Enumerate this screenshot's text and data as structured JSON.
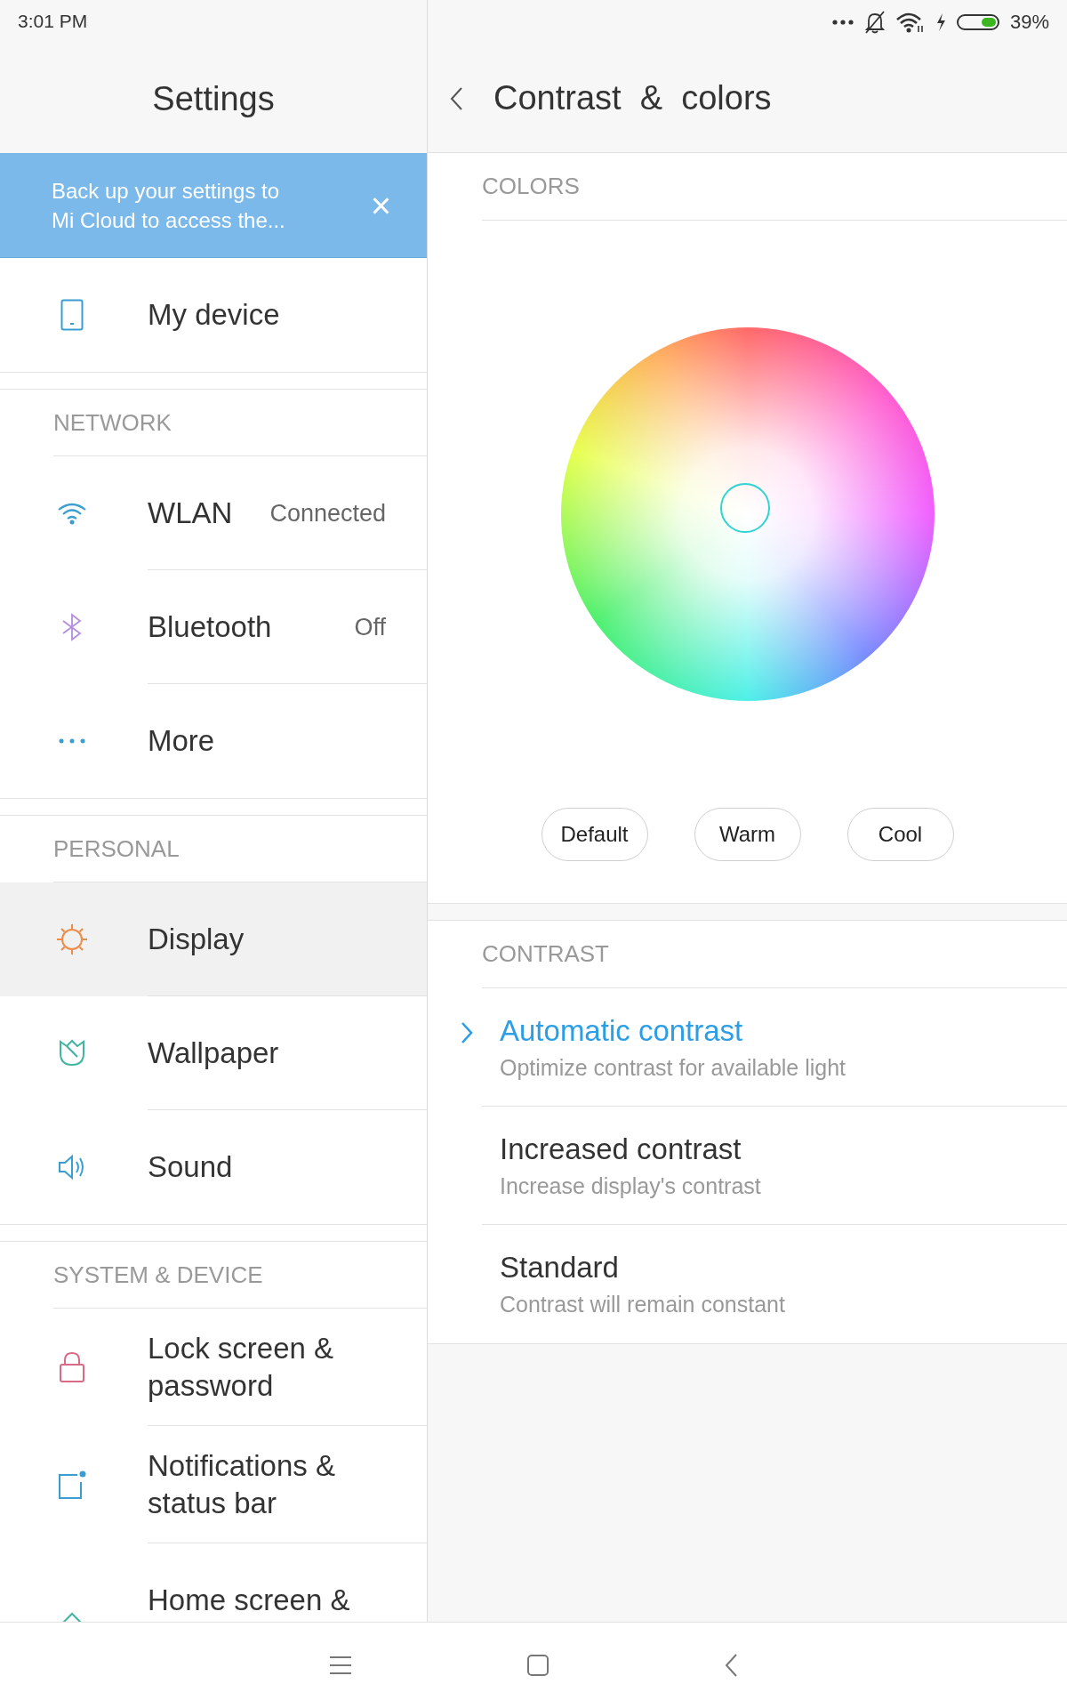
{
  "status_bar": {
    "time": "3:01 PM",
    "battery": "39%"
  },
  "sidebar": {
    "title": "Settings",
    "banner": {
      "text": "Back up your settings to Mi Cloud to access the...",
      "close": "×"
    },
    "sections": [
      {
        "items": [
          {
            "kind": "device",
            "label": "My device",
            "selected": false
          }
        ]
      },
      {
        "header": "NETWORK",
        "items": [
          {
            "kind": "wifi",
            "label": "WLAN",
            "value": "Connected",
            "selected": false
          },
          {
            "kind": "bluetooth",
            "label": "Bluetooth",
            "value": "Off",
            "selected": false
          },
          {
            "kind": "more",
            "label": "More",
            "selected": false
          }
        ]
      },
      {
        "header": "PERSONAL",
        "items": [
          {
            "kind": "display",
            "label": "Display",
            "selected": true
          },
          {
            "kind": "wallpaper",
            "label": "Wallpaper",
            "selected": false
          },
          {
            "kind": "sound",
            "label": "Sound",
            "selected": false
          }
        ]
      },
      {
        "header": "SYSTEM & DEVICE",
        "items": [
          {
            "kind": "lock",
            "label": "Lock screen & password",
            "selected": false
          },
          {
            "kind": "notifications",
            "label": "Notifications & status bar",
            "selected": false
          },
          {
            "kind": "home",
            "label": "Home screen &",
            "selected": false
          }
        ]
      }
    ]
  },
  "detail": {
    "title": "Contrast  &  colors",
    "colors": {
      "header": "COLORS",
      "presets": [
        "Default",
        "Warm",
        "Cool"
      ]
    },
    "contrast": {
      "header": "CONTRAST",
      "options": [
        {
          "title": "Automatic contrast",
          "subtitle": "Optimize contrast for available light",
          "selected": true
        },
        {
          "title": "Increased contrast",
          "subtitle": "Increase display's contrast",
          "selected": false
        },
        {
          "title": "Standard",
          "subtitle": "Contrast will remain constant",
          "selected": false
        }
      ]
    }
  }
}
